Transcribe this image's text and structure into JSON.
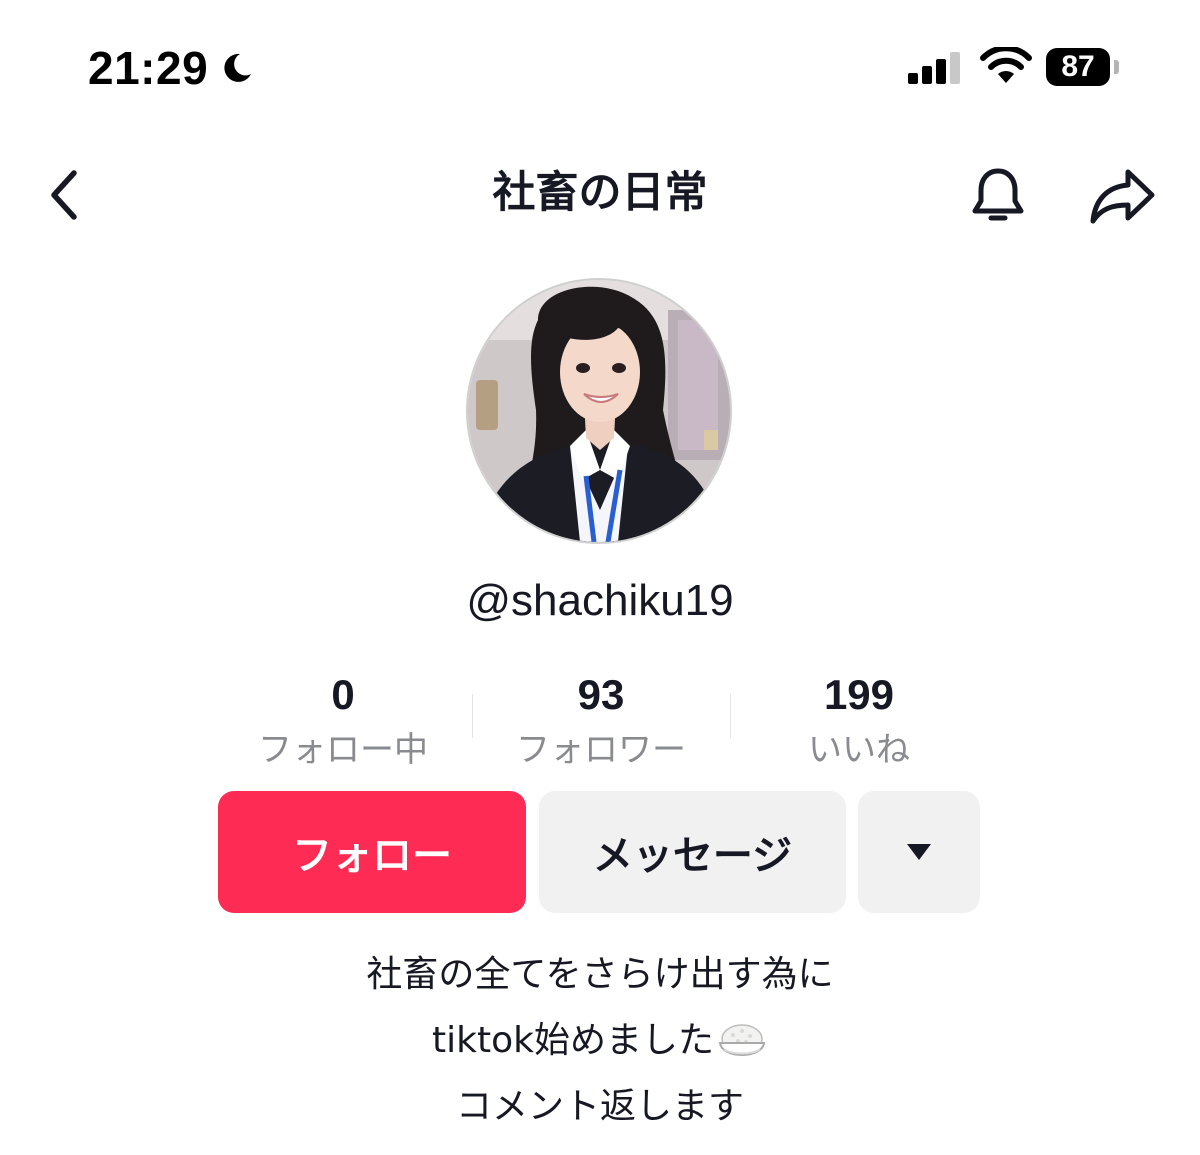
{
  "status_bar": {
    "time": "21:29",
    "battery_level": "87",
    "icons": [
      "moon-icon",
      "cellular-signal-icon",
      "wifi-icon",
      "battery-icon"
    ]
  },
  "header": {
    "title": "社畜の日常",
    "icons": [
      "chevron-left-icon",
      "bell-icon",
      "share-arrow-icon"
    ]
  },
  "profile": {
    "username": "@shachiku19",
    "avatar": "avatar-photo"
  },
  "stats": [
    {
      "value": "0",
      "label": "フォロー中"
    },
    {
      "value": "93",
      "label": "フォロワー"
    },
    {
      "value": "199",
      "label": "いいね"
    }
  ],
  "actions": {
    "follow_label": "フォロー",
    "message_label": "メッセージ",
    "more_icon": "caret-down-icon"
  },
  "bio": {
    "line1": "社畜の全てをさらけ出す為に",
    "line2": "tiktok始めました",
    "line2_emoji": "rice-bowl-icon",
    "line3": "コメント返します"
  },
  "colors": {
    "accent": "#fe2c55",
    "text": "#161823",
    "secondary_text": "#8a8b91",
    "button_gray": "#f1f1f2"
  }
}
